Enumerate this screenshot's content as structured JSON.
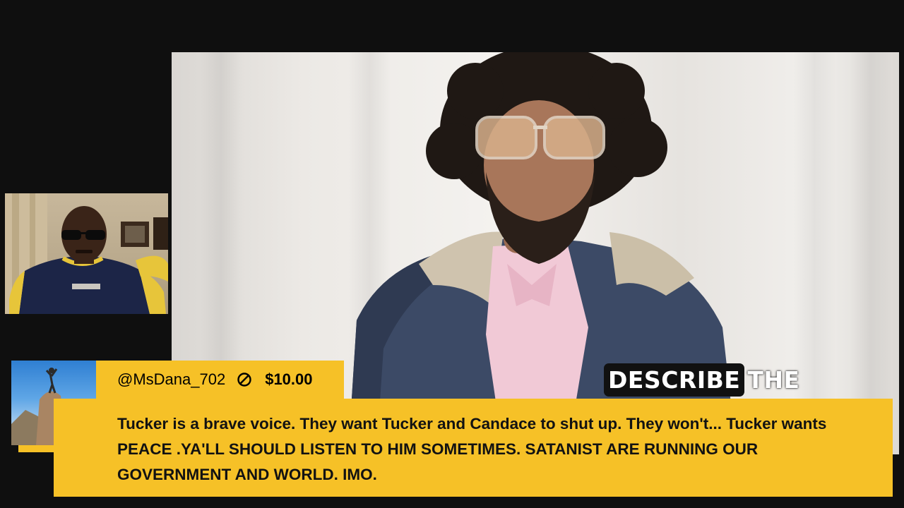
{
  "main_video": {
    "caption_highlight": "DESCRIBE",
    "caption_rest": "THE"
  },
  "super_chat": {
    "username": "@MsDana_702",
    "amount": "$10.00",
    "icon": "block-circle-icon",
    "message": "Tucker is a brave voice. They want Tucker and Candace to shut up. They won't... Tucker wants PEACE .YA'LL SHOULD LISTEN TO HIM SOMETIMES. SATANIST ARE RUNNING OUR GOVERNMENT AND WORLD. IMO.",
    "background_color": "#f6c127",
    "badge_icon": "youtube-play-icon"
  },
  "colors": {
    "page_background": "#0f0f0f",
    "caption_box": "#111111",
    "youtube_red": "#ff0000"
  }
}
